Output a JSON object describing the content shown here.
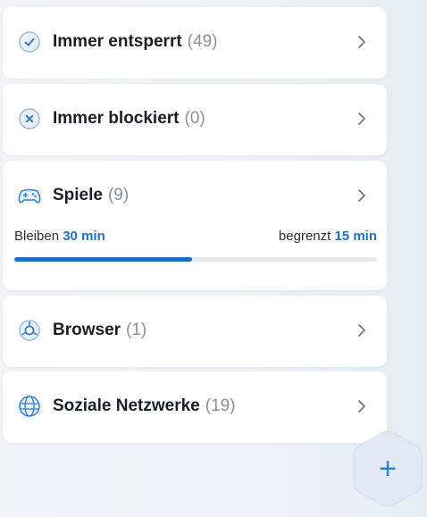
{
  "categories": [
    {
      "id": "always-unlocked",
      "label": "Immer entsperrt",
      "count": "(49)",
      "icon": "check-circle-icon"
    },
    {
      "id": "always-blocked",
      "label": "Immer blockiert",
      "count": "(0)",
      "icon": "x-circle-icon"
    },
    {
      "id": "games",
      "label": "Spiele",
      "count": "(9)",
      "icon": "gamepad-icon"
    },
    {
      "id": "browser",
      "label": "Browser",
      "count": "(1)",
      "icon": "browser-icon"
    },
    {
      "id": "social",
      "label": "Soziale Netzwerke",
      "count": "(19)",
      "icon": "globe-icon"
    }
  ],
  "games_usage": {
    "remaining_label": "Bleiben",
    "remaining_value": "30 min",
    "limit_label": "begrenzt",
    "limit_value": "15 min",
    "progress_fraction": 0.49
  },
  "add_button": {
    "icon": "plus-icon",
    "symbol": "+"
  },
  "colors": {
    "accent": "#1f6fc4",
    "icon_blue": "#2f7fd4",
    "count_gray": "#8a8f99"
  }
}
